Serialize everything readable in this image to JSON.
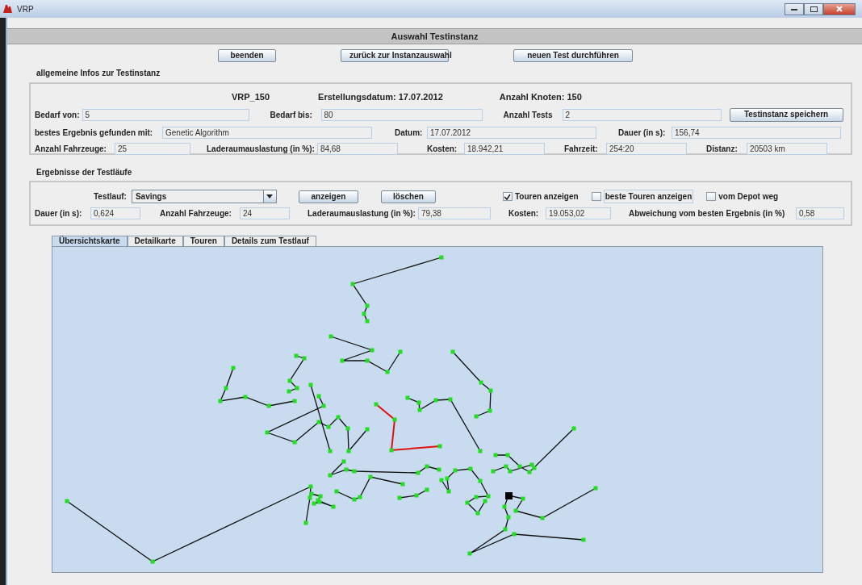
{
  "window": {
    "title": "VRP"
  },
  "header": "Auswahl Testinstanz",
  "buttons": [
    "beenden",
    "zurück zur Instanzauswahl",
    "neuen Test durchführen"
  ],
  "instance_section": {
    "title": "allgemeine Infos zur Testinstanz",
    "summary": [
      "VRP_150",
      "Erstellungsdatum: 17.07.2012",
      "Anzahl Knoten: 150"
    ],
    "rows": [
      [
        {
          "label": "Bedarf von:",
          "value": "5"
        },
        {
          "label": "Bedarf bis:",
          "value": "80"
        },
        {
          "label": "Anzahl Tests",
          "value": "2"
        }
      ],
      [
        {
          "label": "bestes Ergebnis gefunden mit:",
          "value": "Genetic Algorithm"
        },
        {
          "label": "Datum:",
          "value": "17.07.2012"
        },
        {
          "label": "Dauer (in s):",
          "value": "156,74"
        }
      ],
      [
        {
          "label": "Anzahl Fahrzeuge:",
          "value": "25"
        },
        {
          "label": "Laderaumauslastung (in %):",
          "value": "84,68"
        },
        {
          "label": "Kosten:",
          "value": "18.942,21"
        },
        {
          "label": "Fahrzeit:",
          "value": "254:20"
        },
        {
          "label": "Distanz:",
          "value": "20503 km"
        }
      ]
    ],
    "save_button": "Testinstanz speichern"
  },
  "results_section": {
    "title": "Ergebnisse der Testläufe",
    "run_selector": {
      "label": "Testlauf:",
      "value": "Savings"
    },
    "buttons": [
      "anzeigen",
      "löschen"
    ],
    "checkboxes": [
      {
        "label": "Touren anzeigen",
        "checked": true,
        "focused": false
      },
      {
        "label": "beste Touren anzeigen",
        "checked": false,
        "focused": true
      },
      {
        "label": "vom Depot weg",
        "checked": false,
        "focused": false
      }
    ],
    "fields": [
      {
        "label": "Dauer (in s):",
        "value": "0,624"
      },
      {
        "label": "Anzahl Fahrzeuge:",
        "value": "24"
      },
      {
        "label": "Laderaumauslastung (in %):",
        "value": "79,38"
      },
      {
        "label": "Kosten:",
        "value": "19.053,02"
      },
      {
        "label": "Abweichung vom besten Ergebnis (in %)",
        "value": "0,58"
      }
    ]
  },
  "tabs": [
    {
      "label": "Übersichtskarte",
      "selected": true
    },
    {
      "label": "Detailkarte",
      "selected": false
    },
    {
      "label": "Touren",
      "selected": false
    },
    {
      "label": "Details zum Testlauf",
      "selected": false
    }
  ]
}
